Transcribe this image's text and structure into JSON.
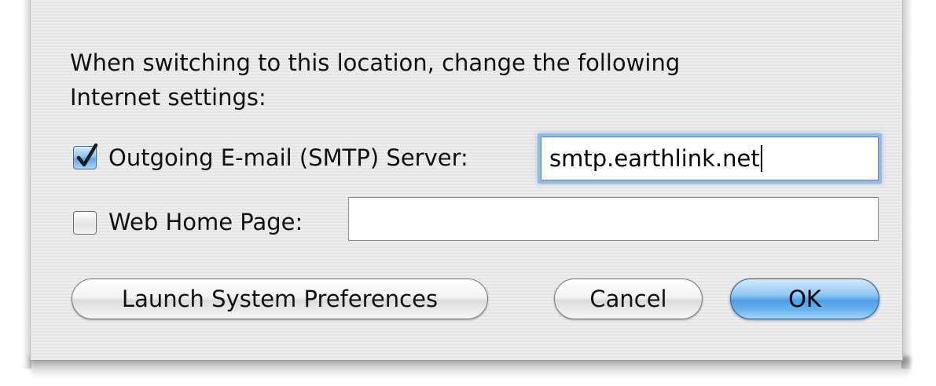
{
  "dialog": {
    "message_line1": "When switching to this location, change the following",
    "message_line2": "Internet settings:"
  },
  "smtp": {
    "checked": true,
    "label": "Outgoing E-mail (SMTP) Server:",
    "value": "smtp.earthlink.net"
  },
  "web_home": {
    "checked": false,
    "label": "Web Home Page:",
    "value": ""
  },
  "buttons": {
    "launch_label": "Launch System Preferences",
    "cancel_label": "Cancel",
    "ok_label": "OK"
  },
  "colors": {
    "dialog_background": "#ececec",
    "default_button": "#4e9ee6",
    "focus_ring": "#94bbe3"
  },
  "icons": {
    "checkmark": "checkmark-icon"
  }
}
